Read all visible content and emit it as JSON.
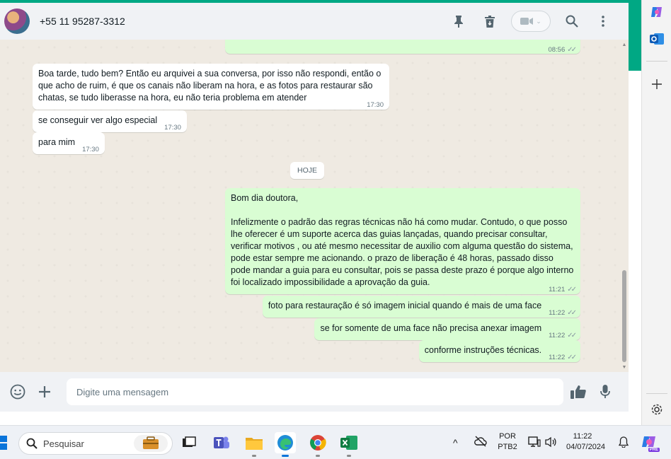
{
  "chat": {
    "contact_name": "+55 11 95287-3312",
    "header_icons": [
      "pin-icon",
      "delete-icon",
      "video-call-icon",
      "search-icon",
      "menu-icon"
    ]
  },
  "messages": [
    {
      "id": "m0",
      "dir": "out",
      "text": "",
      "time": "08:56",
      "read": true
    },
    {
      "id": "m1",
      "dir": "in",
      "text": "Boa tarde, tudo bem? Então eu arquivei a sua conversa, por isso não respondi, então o que acho de ruim, é que os canais não liberam na hora, e as fotos para restaurar são chatas, se tudo liberasse na hora, eu não teria problema em atender",
      "time": "17:30"
    },
    {
      "id": "m2",
      "dir": "in",
      "text": "se conseguir ver algo especial",
      "time": "17:30"
    },
    {
      "id": "m3",
      "dir": "in",
      "text": "para mim",
      "time": "17:30"
    },
    {
      "id": "m4",
      "dir": "out",
      "text": "Bom dia doutora,\n\nInfelizmente o padrão das regras técnicas não há como mudar. Contudo, o que posso lhe oferecer é um suporte acerca das guias lançadas, quando precisar consultar, verificar motivos , ou até mesmo necessitar de auxilio com alguma questão do sistema, pode estar sempre me acionando. o prazo de liberação é 48 horas, passado disso pode mandar a guia para eu consultar, pois se passa deste prazo é porque algo interno foi localizado impossibilidade a aprovação da guia.",
      "time": "11:21",
      "read": true
    },
    {
      "id": "m5",
      "dir": "out",
      "text": "foto para restauração é só imagem inicial quando é mais de uma face",
      "time": "11:22",
      "read": true
    },
    {
      "id": "m6",
      "dir": "out",
      "text": "se for somente de uma face não precisa anexar imagem",
      "time": "11:22",
      "read": true
    },
    {
      "id": "m7",
      "dir": "out",
      "text": "conforme instruções técnicas.",
      "time": "11:22",
      "read": true
    }
  ],
  "date_divider": "HOJE",
  "compose": {
    "placeholder": "Digite uma mensagem"
  },
  "taskbar": {
    "search_placeholder": "Pesquisar",
    "lang_line1": "POR",
    "lang_line2": "PTB2",
    "time": "11:22",
    "date": "04/07/2024",
    "copilot_badge": "PRE"
  },
  "colors": {
    "accent": "#00a884",
    "outgoing_bubble": "#d9fdd3",
    "incoming_bubble": "#ffffff",
    "chat_background": "#efeae2"
  }
}
